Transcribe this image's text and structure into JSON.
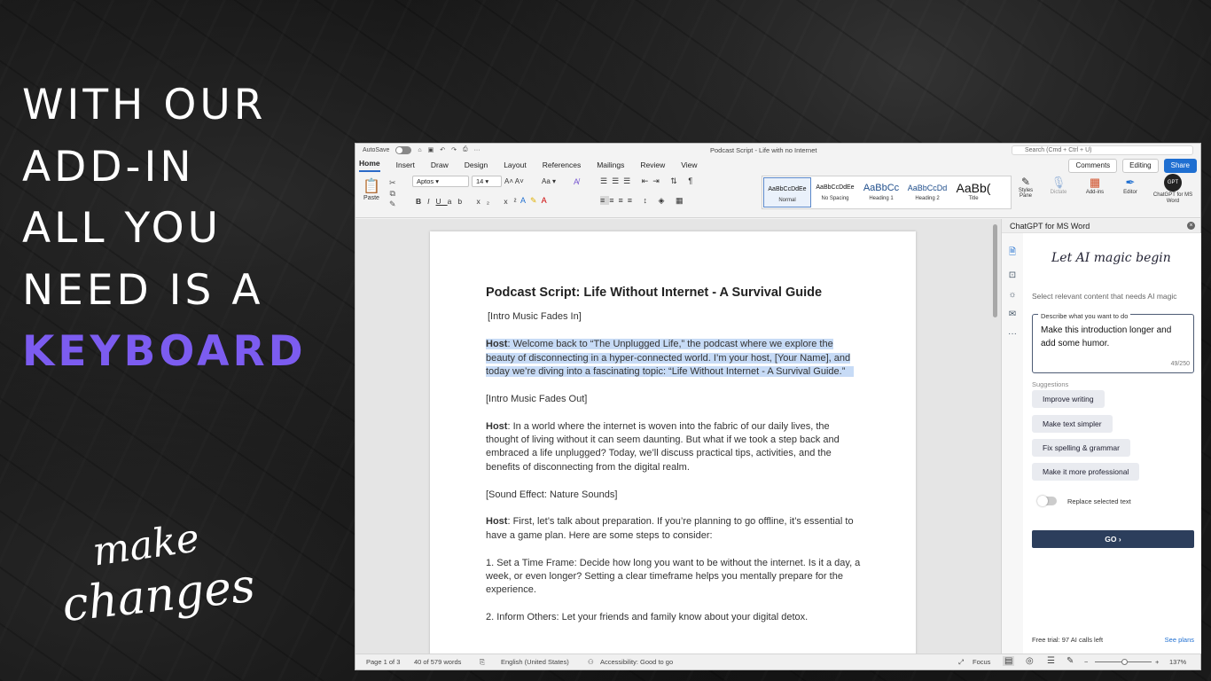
{
  "promo": {
    "line1": "WITH OUR",
    "line2": "ADD-IN",
    "line3": "ALL YOU",
    "line4": "NEED IS A",
    "keyword": "KEYBOARD",
    "script_line1": "make",
    "script_line2": "changes",
    "accent_color": "#7c5cf0"
  },
  "titlebar": {
    "autosave": "AutoSave",
    "doc_title": "Podcast Script - Life with no Internet",
    "search_placeholder": "Search (Cmd + Ctrl + U)"
  },
  "menu": {
    "tabs": [
      "Home",
      "Insert",
      "Draw",
      "Design",
      "Layout",
      "References",
      "Mailings",
      "Review",
      "View"
    ],
    "comments": "Comments",
    "editing": "Editing",
    "share": "Share"
  },
  "ribbon": {
    "paste": "Paste",
    "font": "Aptos",
    "size": "14",
    "styles": [
      {
        "preview": "AaBbCcDdEe",
        "name": "Normal"
      },
      {
        "preview": "AaBbCcDdEe",
        "name": "No Spacing"
      },
      {
        "preview": "AaBbCc",
        "name": "Heading 1"
      },
      {
        "preview": "AaBbCcDd",
        "name": "Heading 2"
      },
      {
        "preview": "AaBb(",
        "name": "Title"
      }
    ],
    "styles_pane": "Styles Pane",
    "dictate": "Dictate",
    "addins": "Add-ins",
    "editor": "Editor",
    "gpt_badge": "GPT",
    "gpt_addin": "ChatGPT for MS Word"
  },
  "document": {
    "title": "Podcast Script: Life Without Internet - A Survival Guide",
    "p1": "[Intro Music Fades In]",
    "host_label": "Host",
    "p2_highlighted": ": Welcome back to “The Unplugged Life,” the podcast where we explore the beauty of disconnecting in a hyper-connected world. I’m your host, [Your Name], and today we’re diving into a fascinating topic: “Life Without Internet - A Survival Guide.”",
    "p3": "[Intro Music Fades Out]",
    "p4": ": In a world where the internet is woven into the fabric of our daily lives, the thought of living without it can seem daunting. But what if we took a step back and embraced a life unplugged? Today, we’ll discuss practical tips, activities, and the benefits of disconnecting from the digital realm.",
    "p5": "[Sound Effect: Nature Sounds]",
    "p6": ": First, let’s talk about preparation. If you’re planning to go offline, it’s essential to have a game plan. Here are some steps to consider:",
    "p7": "1. Set a Time Frame: Decide how long you want to be without the internet. Is it a day, a week, or even longer? Setting a clear timeframe helps you mentally prepare for the experience.",
    "p8": "2. Inform Others: Let your friends and family know about your digital detox."
  },
  "pane": {
    "title": "ChatGPT for MS Word",
    "tagline": "Let AI magic begin",
    "hint": "Select relevant content that needs AI magic",
    "legend": "Describe what you want to do",
    "prompt": "Make this introduction longer and add some humor.",
    "count": "49/250",
    "suggestions_label": "Suggestions",
    "suggestions": [
      "Improve writing",
      "Make text simpler",
      "Fix spelling & grammar",
      "Make it more professional"
    ],
    "replace_label": "Replace selected text",
    "go": "GO  ›",
    "trial": "Free trial: 97 AI calls left",
    "plans": "See plans"
  },
  "status": {
    "page": "Page 1 of 3",
    "words": "40 of 579 words",
    "language": "English (United States)",
    "accessibility": "Accessibility: Good to go",
    "focus": "Focus",
    "zoom": "137%"
  }
}
